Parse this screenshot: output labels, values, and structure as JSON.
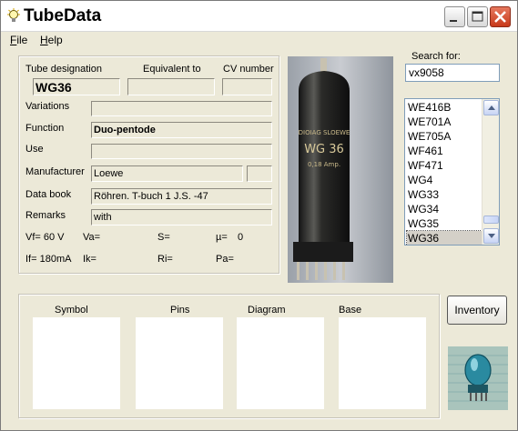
{
  "window": {
    "title": "TubeData"
  },
  "menu": {
    "file_pre": "",
    "file_ul": "F",
    "file_post": "ile",
    "help_pre": "",
    "help_ul": "H",
    "help_post": "elp"
  },
  "labels": {
    "tube_designation": "Tube designation",
    "equivalent_to": "Equivalent to",
    "cv_number": "CV number",
    "variations": "Variations",
    "function": "Function",
    "use": "Use",
    "manufacturer": "Manufacturer",
    "data_book": "Data book",
    "remarks": "Remarks"
  },
  "fields": {
    "tube_designation": "WG36",
    "equivalent_to": "",
    "cv_number": "",
    "variations": "",
    "function": "Duo-pentode",
    "use": "",
    "manufacturer": "Loewe",
    "manufacturer_extra": "",
    "data_book": "Röhren. T-buch 1 J.S. -47",
    "remarks": "with"
  },
  "params": {
    "vf": "Vf= 60 V",
    "va": "Va=",
    "s": "S=",
    "mu_label": "µ=",
    "mu_value": "0",
    "if": "If= 180mA",
    "ik": "Ik=",
    "ri": "Ri=",
    "pa": "Pa="
  },
  "photo": {
    "text1": "DIOIAG SLOEWE",
    "text2": "WG 36",
    "text3": "0,18 Amp."
  },
  "search": {
    "label": "Search for:",
    "value": "vx9058"
  },
  "list": {
    "items": [
      "WE416B",
      "WE701A",
      "WE705A",
      "WF461",
      "WF471",
      "WG4",
      "WG33",
      "WG34",
      "WG35",
      "WG36"
    ],
    "selected": "WG36"
  },
  "panels": {
    "symbol": "Symbol",
    "pins": "Pins",
    "diagram": "Diagram",
    "base": "Base"
  },
  "buttons": {
    "inventory": "Inventory"
  },
  "colors": {
    "titlebar": "#ffffff",
    "close": "#d5492b",
    "window": "#ece9d8"
  }
}
